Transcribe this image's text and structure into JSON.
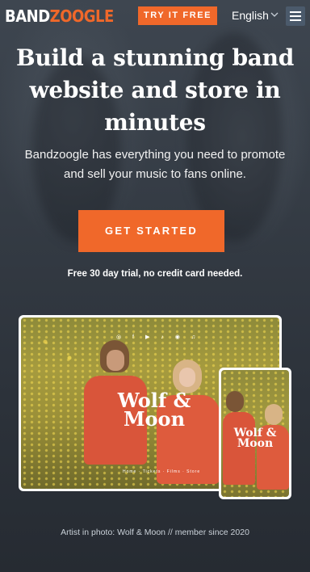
{
  "header": {
    "logo_part1": "BAND",
    "logo_part2": "ZOOGLE",
    "try_label": "TRY IT FREE",
    "language": "English",
    "menu_icon": "hamburger-menu-icon"
  },
  "hero": {
    "headline_lines": [
      "Build a stunning band",
      "website and store in",
      "minutes"
    ],
    "subtitle_lines": [
      "Bandzoogle has everything you need to promote",
      "and sell your music to fans online."
    ],
    "cta_label": "GET STARTED",
    "trial_note": "Free 30 day trial, no credit card needed."
  },
  "mockup": {
    "brand_line1": "Wolf &",
    "brand_line2": "Moon",
    "socials": "◎ f ▶ ♪ ◉ ♫",
    "nav": "Home · Tickets · Films · Store"
  },
  "caption": "Artist in photo: Wolf & Moon // member since 2020",
  "colors": {
    "accent": "#f0682a",
    "background": "#353c45",
    "menu_button": "#4b5a6b"
  }
}
